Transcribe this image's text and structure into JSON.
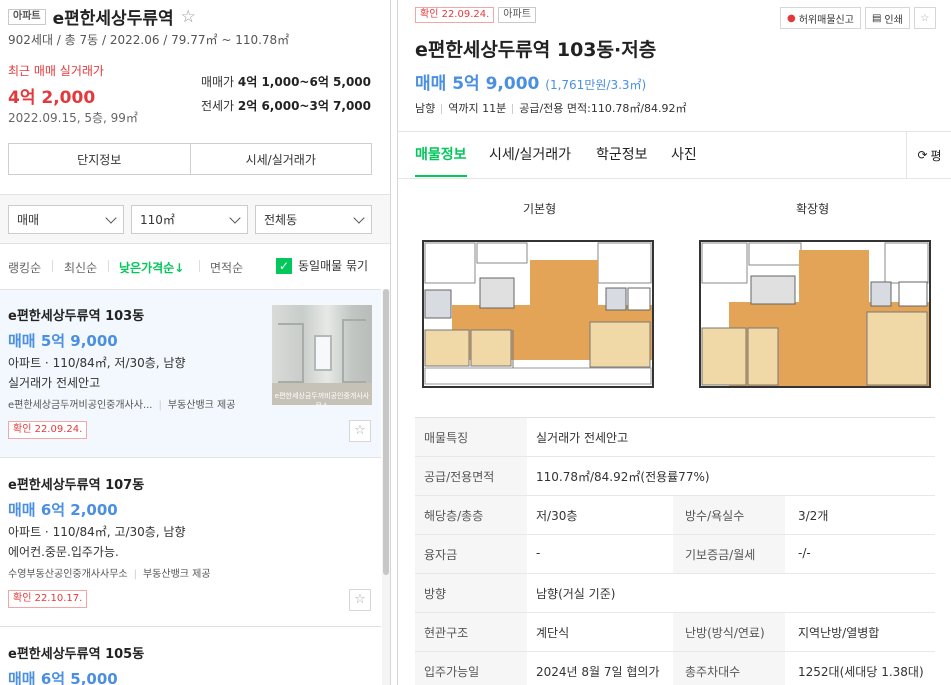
{
  "complex": {
    "tag": "아파트",
    "name": "e편한세상두류역",
    "summary": "902세대 / 총 7동 / 2022.06 / 79.77㎡ ~ 110.78㎡",
    "recent_label": "최근 매매 실거래가",
    "recent_price": "4억 2,000",
    "recent_date": "2022.09.15, 5층, 99㎡",
    "sale_label": "매매가",
    "sale_range": "4억 1,000~6억 5,000",
    "jeonse_label": "전세가",
    "jeonse_range": "2억 6,000~3억 7,000",
    "btn_info": "단지정보",
    "btn_price": "시세/실거래가"
  },
  "filters": {
    "type": "매매",
    "area": "110㎡",
    "dong": "전체동"
  },
  "sort": {
    "ranking": "랭킹순",
    "newest": "최신순",
    "lowprice": "낮은가격순↓",
    "area": "면적순",
    "group": "동일매물 묶기"
  },
  "listings": [
    {
      "title": "e편한세상두류역 103동",
      "price": "매매 5억 9,000",
      "spec": "아파트 · 110/84㎡, 저/30층, 남향",
      "desc": "실거래가 전세안고",
      "agent": "e편한세상금두꺼비공인중개사사...",
      "source": "부동산뱅크 제공",
      "confirm": "확인 22.09.24.",
      "photo_caption": "e편한세상금두꺼비공인중개사사무소"
    },
    {
      "title": "e편한세상두류역 107동",
      "price": "매매 6억 2,000",
      "spec": "아파트 · 110/84㎡, 고/30층, 남향",
      "desc": "에어컨.중문.입주가능.",
      "agent": "수영부동산공인중개사사무소",
      "source": "부동산뱅크 제공",
      "confirm": "확인 22.10.17."
    },
    {
      "title": "e편한세상두류역 105동",
      "price": "매매 6억 5,000"
    }
  ],
  "detail": {
    "confirm": "확인 22.09.24.",
    "tag": "아파트",
    "report_btn": "허위매물신고",
    "print_btn": "인쇄",
    "title": "e편한세상두류역 103동·저층",
    "price": "매매 5억 9,000",
    "price_per": "(1,761만원/3.3㎡)",
    "direction": "남향",
    "station": "역까지 11분",
    "area": "공급/전용 면적:110.78㎡/84.92㎡",
    "tabs": [
      "매물정보",
      "시세/실거래가",
      "학군정보",
      "사진"
    ],
    "tab_more": "평",
    "floorplan_basic": "기본형",
    "floorplan_extended": "확장형",
    "rows": [
      {
        "k": "매물특징",
        "v": "실거래가 전세안고"
      },
      {
        "k": "공급/전용면적",
        "v": "110.78㎡/84.92㎡(전용률77%)"
      },
      {
        "k": "해당층/총층",
        "v": "저/30층",
        "k2": "방수/욕실수",
        "v2": "3/2개"
      },
      {
        "k": "융자금",
        "v": "-",
        "k2": "기보증금/월세",
        "v2": "-/-"
      },
      {
        "k": "방향",
        "v": "남향(거실 기준)"
      },
      {
        "k": "현관구조",
        "v": "계단식",
        "k2": "난방(방식/연료)",
        "v2": "지역난방/열병합"
      },
      {
        "k": "입주가능일",
        "v": "2024년 8월 7일 협의가",
        "k2": "총주차대수",
        "v2": "1252대(세대당 1.38대)"
      }
    ]
  },
  "colors": {
    "accent_green": "#03c75a",
    "price_blue": "#4a8fe2",
    "red": "#e4393c"
  }
}
